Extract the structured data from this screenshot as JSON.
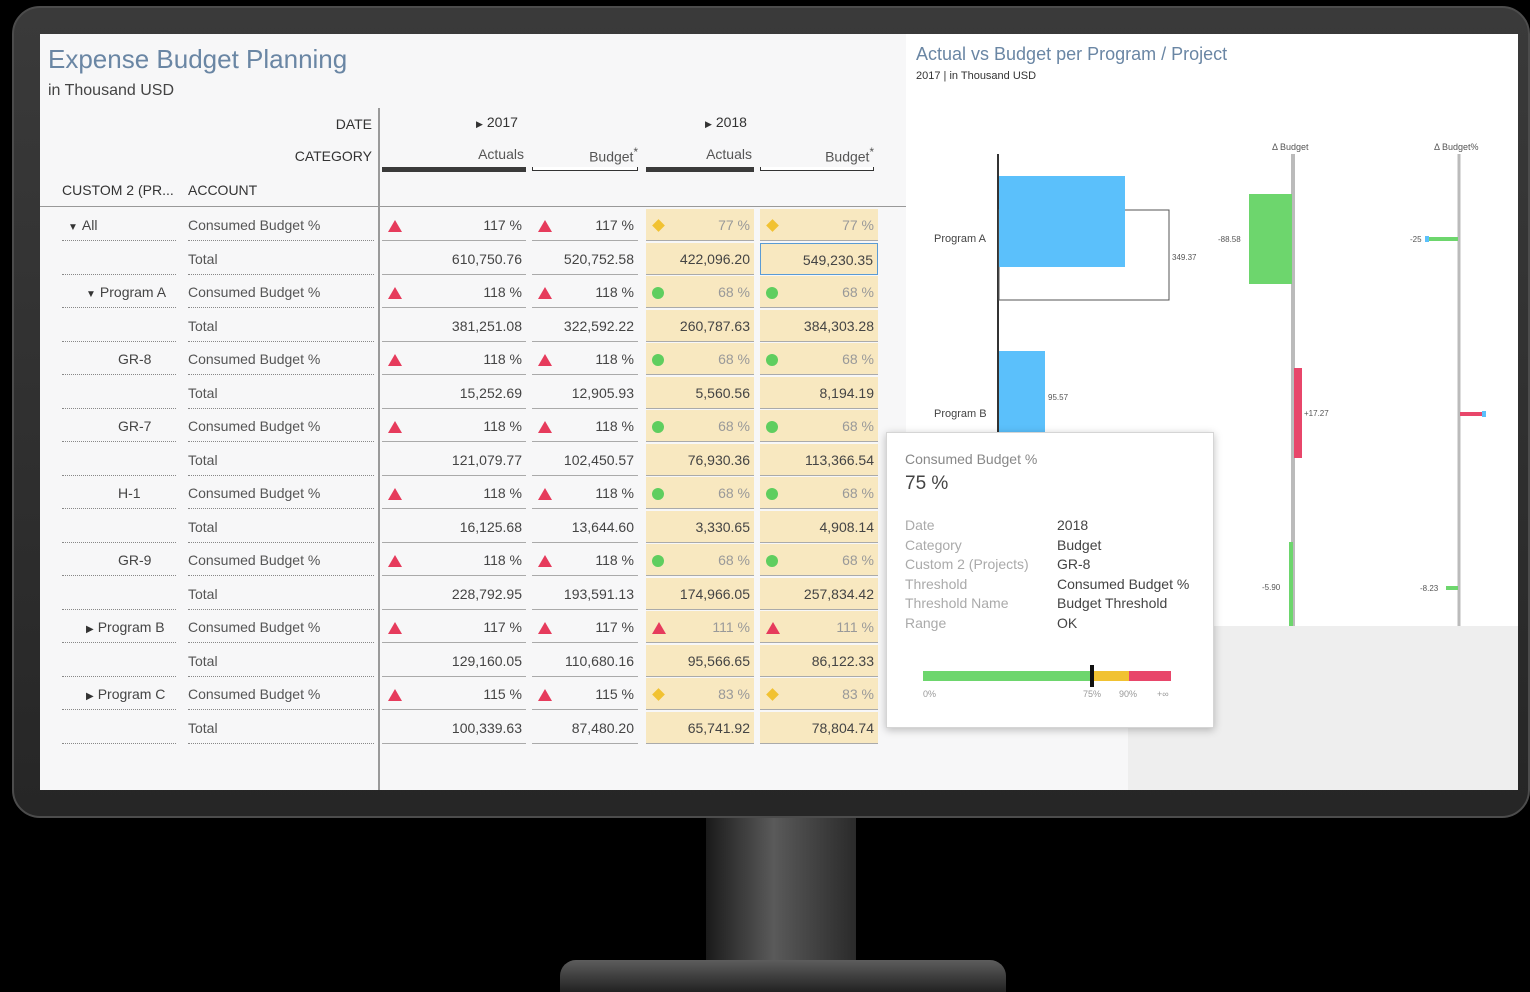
{
  "report": {
    "title": "Expense Budget Planning",
    "subtitle": "in Thousand USD",
    "header_labels": {
      "date": "DATE",
      "category": "CATEGORY",
      "dim1": "CUSTOM 2 (PR...",
      "dim2": "ACCOUNT"
    },
    "years": [
      "2017",
      "2018"
    ],
    "columns": [
      "Actuals",
      "Budget",
      "Actuals",
      "Budget"
    ],
    "budget_marker": "*"
  },
  "rows": [
    {
      "dim1": "All",
      "expander": "▼",
      "dim2": "Consumed Budget %",
      "v": [
        "117 %",
        "117 %",
        "77 %",
        "77 %"
      ],
      "ind": [
        "tri",
        "tri",
        "diam",
        "diam"
      ]
    },
    {
      "dim1": "",
      "expander": "",
      "dim2": "Total",
      "v": [
        "610,750.76",
        "520,752.58",
        "422,096.20",
        "549,230.35"
      ],
      "ind": [
        "",
        "",
        "",
        ""
      ]
    },
    {
      "dim1": "Program A",
      "expander": "▼",
      "dim2": "Consumed Budget %",
      "v": [
        "118 %",
        "118 %",
        "68 %",
        "68 %"
      ],
      "ind": [
        "tri",
        "tri",
        "circ",
        "circ"
      ]
    },
    {
      "dim1": "",
      "expander": "",
      "dim2": "Total",
      "v": [
        "381,251.08",
        "322,592.22",
        "260,787.63",
        "384,303.28"
      ],
      "ind": [
        "",
        "",
        "",
        ""
      ]
    },
    {
      "dim1": "GR-8",
      "expander": "",
      "dim2": "Consumed Budget %",
      "v": [
        "118 %",
        "118 %",
        "68 %",
        "68 %"
      ],
      "ind": [
        "tri",
        "tri",
        "circ",
        "circ"
      ]
    },
    {
      "dim1": "",
      "expander": "",
      "dim2": "Total",
      "v": [
        "15,252.69",
        "12,905.93",
        "5,560.56",
        "8,194.19"
      ],
      "ind": [
        "",
        "",
        "",
        ""
      ]
    },
    {
      "dim1": "GR-7",
      "expander": "",
      "dim2": "Consumed Budget %",
      "v": [
        "118 %",
        "118 %",
        "68 %",
        "68 %"
      ],
      "ind": [
        "tri",
        "tri",
        "circ",
        "circ"
      ]
    },
    {
      "dim1": "",
      "expander": "",
      "dim2": "Total",
      "v": [
        "121,079.77",
        "102,450.57",
        "76,930.36",
        "113,366.54"
      ],
      "ind": [
        "",
        "",
        "",
        ""
      ]
    },
    {
      "dim1": "H-1",
      "expander": "",
      "dim2": "Consumed Budget %",
      "v": [
        "118 %",
        "118 %",
        "68 %",
        "68 %"
      ],
      "ind": [
        "tri",
        "tri",
        "circ",
        "circ"
      ]
    },
    {
      "dim1": "",
      "expander": "",
      "dim2": "Total",
      "v": [
        "16,125.68",
        "13,644.60",
        "3,330.65",
        "4,908.14"
      ],
      "ind": [
        "",
        "",
        "",
        ""
      ]
    },
    {
      "dim1": "GR-9",
      "expander": "",
      "dim2": "Consumed Budget %",
      "v": [
        "118 %",
        "118 %",
        "68 %",
        "68 %"
      ],
      "ind": [
        "tri",
        "tri",
        "circ",
        "circ"
      ]
    },
    {
      "dim1": "",
      "expander": "",
      "dim2": "Total",
      "v": [
        "228,792.95",
        "193,591.13",
        "174,966.05",
        "257,834.42"
      ],
      "ind": [
        "",
        "",
        "",
        ""
      ]
    },
    {
      "dim1": "Program B",
      "expander": "▶",
      "dim2": "Consumed Budget %",
      "v": [
        "117 %",
        "117 %",
        "111 %",
        "111 %"
      ],
      "ind": [
        "tri",
        "tri",
        "tri",
        "tri"
      ]
    },
    {
      "dim1": "",
      "expander": "",
      "dim2": "Total",
      "v": [
        "129,160.05",
        "110,680.16",
        "95,566.65",
        "86,122.33"
      ],
      "ind": [
        "",
        "",
        "",
        ""
      ]
    },
    {
      "dim1": "Program C",
      "expander": "▶",
      "dim2": "Consumed Budget %",
      "v": [
        "115 %",
        "115 %",
        "83 %",
        "83 %"
      ],
      "ind": [
        "tri",
        "tri",
        "diam",
        "diam"
      ]
    },
    {
      "dim1": "",
      "expander": "",
      "dim2": "Total",
      "v": [
        "100,339.63",
        "87,480.20",
        "65,741.92",
        "78,804.74"
      ],
      "ind": [
        "",
        "",
        "",
        ""
      ]
    }
  ],
  "colors": {
    "tri": "#e63b5c",
    "circ": "#5fce5f",
    "diam": "#f1c232",
    "highlight": "#f8e8c0",
    "bar_blue": "#5bc0fb",
    "green": "#6dd66d",
    "red": "#e8466a"
  },
  "chart": {
    "title": "Actual vs Budget per Program / Project",
    "subtitle": "2017 | in Thousand USD",
    "delta_budget_label": "Δ Budget",
    "delta_budget_pct_label": "Δ Budget%",
    "programs": [
      "Program A",
      "Program B"
    ],
    "labels": {
      "a_budget": "349.37",
      "b_actual": "95.57",
      "a_delta": "-88.58",
      "b_delta": "+17.27",
      "c_delta": "-5.90",
      "a_pct": "-25",
      "c_pct": "-8.23"
    }
  },
  "chart_data": {
    "type": "bar",
    "title": "Actual vs Budget per Program / Project",
    "subtitle": "2017 | in Thousand USD",
    "categories": [
      "Program A",
      "Program B"
    ],
    "series": [
      {
        "name": "Actual",
        "values": [
          null,
          95.57
        ]
      },
      {
        "name": "Budget",
        "values": [
          349.37,
          null
        ]
      },
      {
        "name": "Δ Budget",
        "values": [
          -88.58,
          17.27
        ]
      },
      {
        "name": "Δ Budget%",
        "values": [
          -25,
          null
        ]
      }
    ]
  },
  "tooltip": {
    "metric": "Consumed Budget %",
    "value": "75 %",
    "fields": [
      {
        "k": "Date",
        "v": "2018"
      },
      {
        "k": "Category",
        "v": "Budget"
      },
      {
        "k": "Custom 2 (Projects)",
        "v": "GR-8"
      },
      {
        "k": "Threshold",
        "v": "Consumed Budget %"
      },
      {
        "k": "Threshold Name",
        "v": "Budget Threshold"
      },
      {
        "k": "Range",
        "v": "OK"
      }
    ],
    "range_labels": [
      "0%",
      "75%",
      "90%",
      "+∞"
    ],
    "marker_fraction": 0.75
  }
}
